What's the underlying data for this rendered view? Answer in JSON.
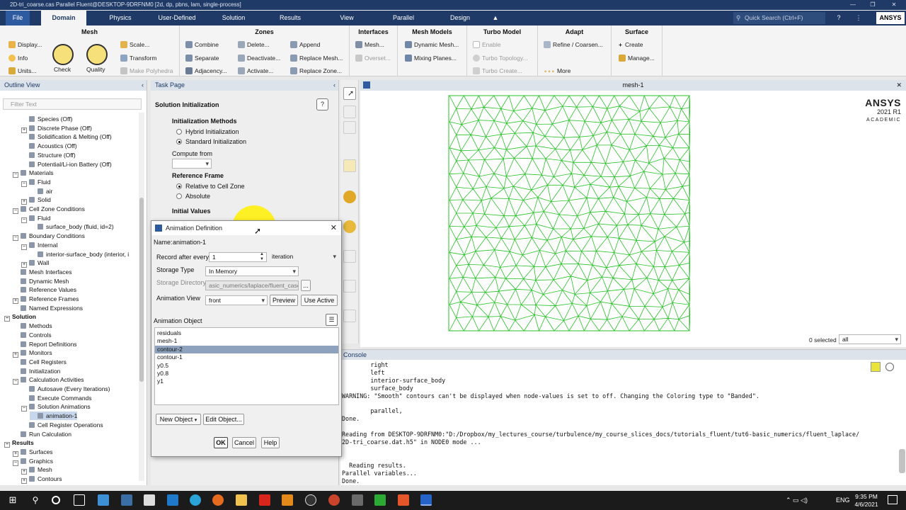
{
  "window": {
    "title": "2D-tri_coarse.cas Parallel Fluent@DESKTOP-9DRFNM0 [2d, dp, pbns, lam, single-process]",
    "controls": [
      "—",
      "❐",
      "✕"
    ]
  },
  "ribbon_tabs": [
    "File",
    "Domain",
    "Physics",
    "User-Defined",
    "Solution",
    "Results",
    "View",
    "Parallel",
    "Design"
  ],
  "quick_search_placeholder": "Quick Search (Ctrl+F)",
  "brand": "ANSYS",
  "ribbon": {
    "mesh": {
      "title": "Mesh",
      "display": "Display...",
      "info": "Info",
      "units": "Units...",
      "check": "Check",
      "quality": "Quality",
      "scale": "Scale...",
      "transform": "Transform",
      "make_polyhedra": "Make Polyhedra"
    },
    "zones": {
      "title": "Zones",
      "combine": "Combine",
      "separate": "Separate",
      "adjacency": "Adjacency...",
      "delete": "Delete...",
      "deactivate": "Deactivate...",
      "activate": "Activate...",
      "append": "Append",
      "replace_mesh": "Replace Mesh...",
      "replace_zone": "Replace Zone..."
    },
    "interfaces": {
      "title": "Interfaces",
      "mesh": "Mesh...",
      "overset": "Overset..."
    },
    "mesh_models": {
      "title": "Mesh Models",
      "dynamic_mesh": "Dynamic Mesh...",
      "mixing_planes": "Mixing Planes..."
    },
    "turbo_model": {
      "title": "Turbo Model",
      "enable": "Enable",
      "turbo_topology": "Turbo Topology...",
      "turbo_create": "Turbo Create..."
    },
    "adapt": {
      "title": "Adapt",
      "refine": "Refine / Coarsen...",
      "more": "More"
    },
    "surface": {
      "title": "Surface",
      "create": "Create",
      "manage": "Manage..."
    }
  },
  "outline": {
    "title": "Outline View",
    "filter_placeholder": "Filter Text",
    "items": [
      {
        "label": "Species (Off)",
        "level": 3,
        "toggle": ""
      },
      {
        "label": "Discrete Phase (Off)",
        "level": 3,
        "toggle": "+"
      },
      {
        "label": "Solidification & Melting (Off)",
        "level": 3,
        "toggle": ""
      },
      {
        "label": "Acoustics (Off)",
        "level": 3,
        "toggle": ""
      },
      {
        "label": "Structure (Off)",
        "level": 3,
        "toggle": ""
      },
      {
        "label": "Potential/Li-ion Battery (Off)",
        "level": 3,
        "toggle": ""
      },
      {
        "label": "Materials",
        "level": 2,
        "toggle": "−"
      },
      {
        "label": "Fluid",
        "level": 3,
        "toggle": "−"
      },
      {
        "label": "air",
        "level": 4,
        "toggle": ""
      },
      {
        "label": "Solid",
        "level": 3,
        "toggle": "+"
      },
      {
        "label": "Cell Zone Conditions",
        "level": 2,
        "toggle": "−"
      },
      {
        "label": "Fluid",
        "level": 3,
        "toggle": "−"
      },
      {
        "label": "surface_body (fluid, id=2)",
        "level": 4,
        "toggle": ""
      },
      {
        "label": "Boundary Conditions",
        "level": 2,
        "toggle": "−"
      },
      {
        "label": "Internal",
        "level": 3,
        "toggle": "−"
      },
      {
        "label": "interior-surface_body (interior, i",
        "level": 4,
        "toggle": ""
      },
      {
        "label": "Wall",
        "level": 3,
        "toggle": "+"
      },
      {
        "label": "Mesh Interfaces",
        "level": 2,
        "toggle": ""
      },
      {
        "label": "Dynamic Mesh",
        "level": 2,
        "toggle": ""
      },
      {
        "label": "Reference Values",
        "level": 2,
        "toggle": ""
      },
      {
        "label": "Reference Frames",
        "level": 2,
        "toggle": "+"
      },
      {
        "label": "Named Expressions",
        "level": 2,
        "toggle": ""
      },
      {
        "label": "Solution",
        "level": 1,
        "toggle": "−",
        "bold": true
      },
      {
        "label": "Methods",
        "level": 2,
        "toggle": ""
      },
      {
        "label": "Controls",
        "level": 2,
        "toggle": ""
      },
      {
        "label": "Report Definitions",
        "level": 2,
        "toggle": ""
      },
      {
        "label": "Monitors",
        "level": 2,
        "toggle": "+"
      },
      {
        "label": "Cell Registers",
        "level": 2,
        "toggle": ""
      },
      {
        "label": "Initialization",
        "level": 2,
        "toggle": ""
      },
      {
        "label": "Calculation Activities",
        "level": 2,
        "toggle": "−"
      },
      {
        "label": "Autosave (Every Iterations)",
        "level": 3,
        "toggle": ""
      },
      {
        "label": "Execute Commands",
        "level": 3,
        "toggle": ""
      },
      {
        "label": "Solution Animations",
        "level": 3,
        "toggle": "−"
      },
      {
        "label": "animation-1",
        "level": 4,
        "toggle": "",
        "selected": true
      },
      {
        "label": "Cell Register Operations",
        "level": 3,
        "toggle": ""
      },
      {
        "label": "Run Calculation",
        "level": 2,
        "toggle": ""
      },
      {
        "label": "Results",
        "level": 1,
        "toggle": "−",
        "bold": true
      },
      {
        "label": "Surfaces",
        "level": 2,
        "toggle": "+"
      },
      {
        "label": "Graphics",
        "level": 2,
        "toggle": "−"
      },
      {
        "label": "Mesh",
        "level": 3,
        "toggle": "+"
      },
      {
        "label": "Contours",
        "level": 3,
        "toggle": "+"
      }
    ]
  },
  "task_page": {
    "title": "Task Page",
    "heading": "Solution Initialization",
    "init_methods_label": "Initialization Methods",
    "hybrid": "Hybrid  Initialization",
    "standard": "Standard Initialization",
    "compute_from_label": "Compute from",
    "reference_frame_label": "Reference Frame",
    "relative": "Relative to Cell Zone",
    "absolute": "Absolute",
    "initial_values_label": "Initial Values"
  },
  "dialog": {
    "title": "Animation Definition",
    "name_label": "Name",
    "name_value": "animation-1",
    "record_label": "Record after every",
    "record_value": "1",
    "record_unit": "iteration",
    "storage_type_label": "Storage Type",
    "storage_type_value": "In Memory",
    "storage_dir_label": "Storage Directory",
    "storage_dir_value": "asic_numerics/laplace/fluent_case",
    "browse": "...",
    "animation_view_label": "Animation View",
    "animation_view_value": "front",
    "preview": "Preview",
    "use_active": "Use Active",
    "animation_object_label": "Animation Object",
    "objects": [
      "residuals",
      "mesh-1",
      "contour-2",
      "contour-1",
      "y0.5",
      "y0.8",
      "y1"
    ],
    "selected_object": "contour-2",
    "new_object": "New Object",
    "edit_object": "Edit Object...",
    "ok": "OK",
    "cancel": "Cancel",
    "help": "Help"
  },
  "graphics": {
    "title": "mesh-1",
    "logo_line1": "ANSYS",
    "logo_line2": "2021 R1",
    "logo_line3": "ACADEMIC",
    "selected_count": "0 selected",
    "selection_filter": "all",
    "mesh_color": "#27c227"
  },
  "console": {
    "title": "Console",
    "lines": [
      "        right",
      "        left",
      "        interior-surface_body",
      "        surface_body",
      "WARNING: \"Smooth\" contours can't be displayed when node-values is set to off. Changing the Coloring type to \"Banded\".",
      "",
      "        parallel,",
      "Done.",
      "",
      "Reading from DESKTOP-9DRFNM0:\"D:/Dropbox/my_lectures_course/turbulence/my_course_slices_docs/tutorials_fluent/tut6-basic_numerics/fluent_laplace/",
      "2D-tri_coarse.dat.h5\" in NODE0 mode ...",
      "",
      "",
      "  Reading results.",
      "Parallel variables...",
      "Done."
    ]
  },
  "taskbar": {
    "language": "ENG",
    "time": "9:35 PM",
    "date": "4/6/2021"
  }
}
